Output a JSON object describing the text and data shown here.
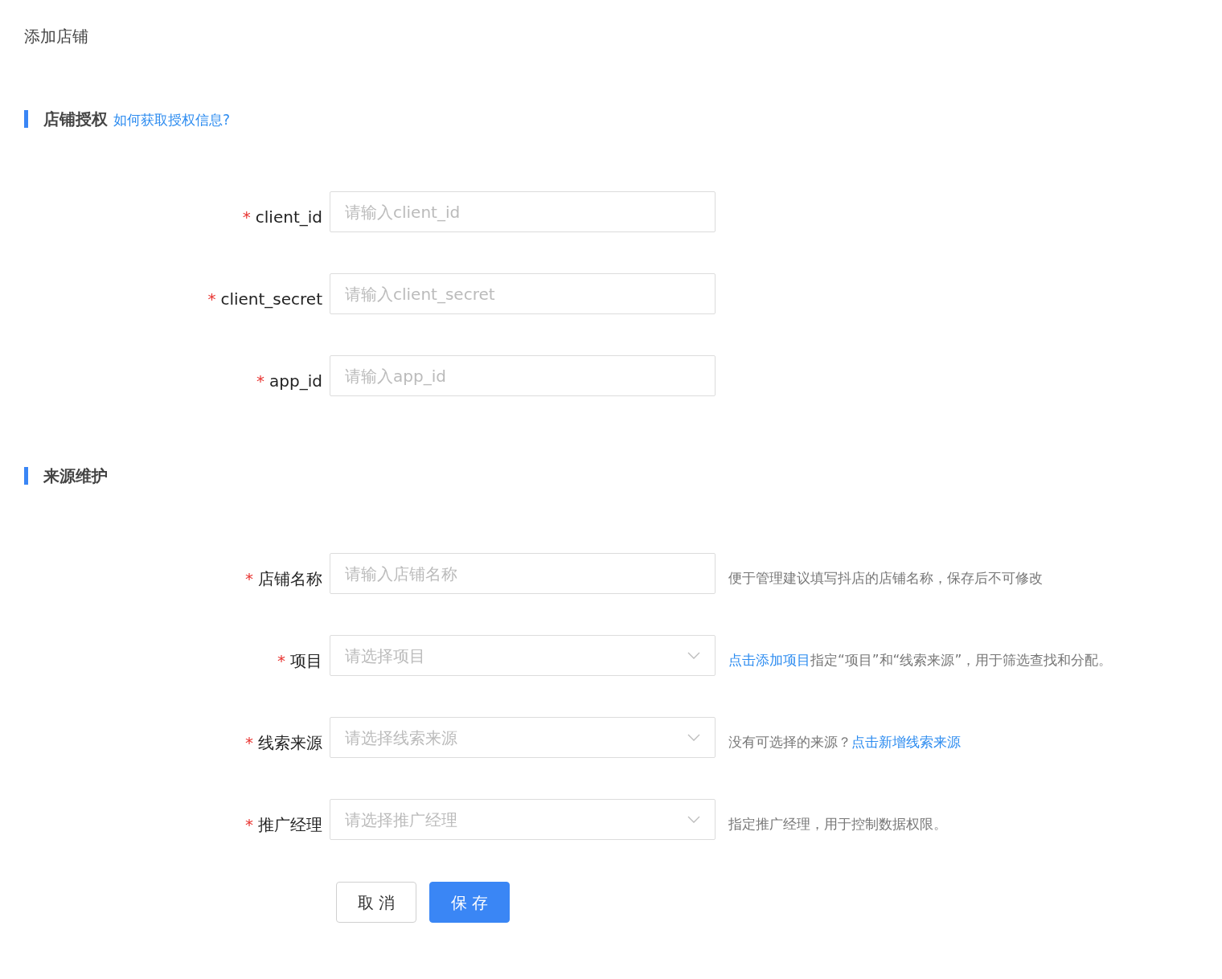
{
  "page_title": "添加店铺",
  "sections": [
    {
      "title": "店铺授权",
      "link": "如何获取授权信息?",
      "fields": [
        {
          "kind": "input",
          "required_mark": "*",
          "label": "client_id",
          "placeholder": "请输入client_id"
        },
        {
          "kind": "input",
          "required_mark": "*",
          "label": "client_secret",
          "placeholder": "请输入client_secret"
        },
        {
          "kind": "input",
          "required_mark": "*",
          "label": "app_id",
          "placeholder": "请输入app_id"
        }
      ]
    },
    {
      "title": "来源维护",
      "fields": [
        {
          "kind": "input",
          "required_mark": "*",
          "label": "店铺名称",
          "placeholder": "请输入店铺名称",
          "hint": [
            {
              "text": "便于管理建议填写抖店的店铺名称，保存后不可修改",
              "link": false
            }
          ]
        },
        {
          "kind": "select",
          "required_mark": "*",
          "label": "项目",
          "placeholder": "请选择项目",
          "hint": [
            {
              "text": "点击添加项目",
              "link": true
            },
            {
              "text": "指定“项目”和“线索来源”，用于筛选查找和分配。",
              "link": false
            }
          ]
        },
        {
          "kind": "select",
          "required_mark": "*",
          "label": "线索来源",
          "placeholder": "请选择线索来源",
          "hint": [
            {
              "text": "没有可选择的来源？",
              "link": false
            },
            {
              "text": "点击新增线索来源",
              "link": true
            }
          ]
        },
        {
          "kind": "select",
          "required_mark": "*",
          "label": "推广经理",
          "placeholder": "请选择推广经理",
          "hint": [
            {
              "text": "指定推广经理，用于控制数据权限。",
              "link": false
            }
          ]
        }
      ]
    }
  ],
  "buttons": [
    {
      "label": "取 消",
      "kind": "default"
    },
    {
      "label": "保 存",
      "kind": "primary"
    }
  ]
}
